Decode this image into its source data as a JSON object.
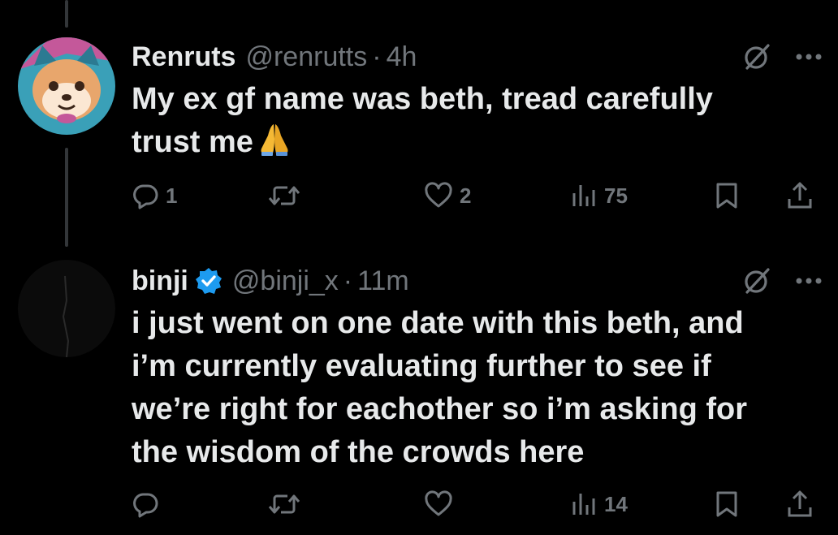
{
  "tweets": [
    {
      "display_name": "Renruts",
      "handle": "@renrutts",
      "separator": "·",
      "time": "4h",
      "text_lines": [
        "My ex gf name was beth, tread carefully",
        "trust me"
      ],
      "emoji": "folded-hands",
      "verified": false,
      "actions": {
        "replies": "1",
        "reposts": "",
        "likes": "2",
        "views": "75"
      }
    },
    {
      "display_name": "binji",
      "handle": "@binji_x",
      "separator": "·",
      "time": "11m",
      "text_lines": [
        "i just went on one date with this beth, and",
        "i’m currently evaluating further to see if",
        "we’re right for eachother so i’m asking for",
        "the wisdom of the crowds here"
      ],
      "verified": true,
      "actions": {
        "replies": "",
        "reposts": "",
        "likes": "",
        "views": "14"
      }
    }
  ],
  "icons": {
    "reply": "reply-icon",
    "repost": "repost-icon",
    "like": "heart-icon",
    "views": "views-icon",
    "bookmark": "bookmark-icon",
    "share": "share-icon",
    "grok": "grok-icon",
    "more": "more-icon",
    "verified": "verified-badge-icon"
  },
  "colors": {
    "background": "#000000",
    "text_primary": "#e7e9ea",
    "text_secondary": "#71767b",
    "verified_blue": "#1d9bf0",
    "thread_line": "#333639"
  }
}
